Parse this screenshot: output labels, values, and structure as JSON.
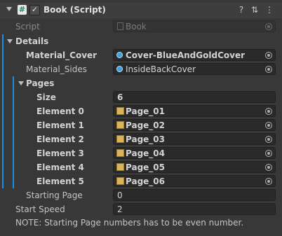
{
  "header": {
    "title": "Book (Script)",
    "script_glyph": "#",
    "checkbox_mark": "✓"
  },
  "header_icons": {
    "help": "?",
    "presets": "⇅",
    "menu": "⋮"
  },
  "script_field": {
    "label": "Script",
    "value": "Book"
  },
  "details": {
    "label": "Details",
    "material_cover": {
      "label": "Material_Cover",
      "value": "Cover-BlueAndGoldCover"
    },
    "material_sides": {
      "label": "Material_Sides",
      "value": "InsideBackCover"
    },
    "pages": {
      "label": "Pages",
      "size_label": "Size",
      "size_value": "6",
      "elements": [
        {
          "label": "Element 0",
          "value": "Page_01"
        },
        {
          "label": "Element 1",
          "value": "Page_02"
        },
        {
          "label": "Element 2",
          "value": "Page_03"
        },
        {
          "label": "Element 3",
          "value": "Page_04"
        },
        {
          "label": "Element 4",
          "value": "Page_05"
        },
        {
          "label": "Element 5",
          "value": "Page_06"
        }
      ]
    },
    "starting_page": {
      "label": "Starting Page",
      "value": "0"
    }
  },
  "start_speed": {
    "label": "Start Speed",
    "value": "2"
  },
  "note": "NOTE: Starting Page numbers has to be even number.",
  "colors": {
    "modified_bar": "#1d8fe1",
    "background": "#383838"
  }
}
